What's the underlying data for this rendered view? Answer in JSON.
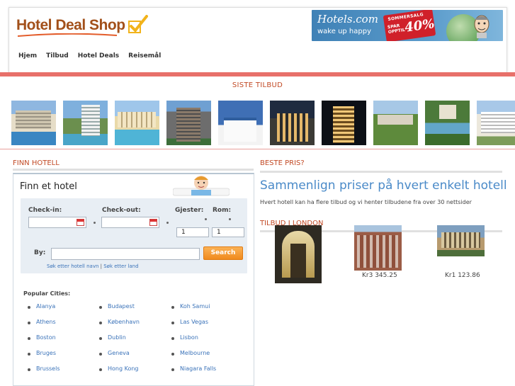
{
  "logo": {
    "text": "Hotel Deal Shop",
    "check_color": "#f2b31b"
  },
  "banner": {
    "brand": "Hotels.com",
    "tagline": "wake up happy",
    "sale_title": "SOMMERSALG",
    "sale_sub1": "SPAR",
    "sale_sub2": "OPPTIL",
    "sale_value": "40%"
  },
  "nav": {
    "items": [
      "Hjem",
      "Tilbud",
      "Hotel Deals",
      "Reisemål"
    ]
  },
  "latest": {
    "title": "SISTE TILBUD",
    "thumbs": [
      "hotel-thumb-1",
      "hotel-thumb-2",
      "hotel-thumb-3",
      "hotel-thumb-4",
      "hotel-thumb-5",
      "hotel-thumb-6",
      "hotel-thumb-7",
      "hotel-thumb-8",
      "hotel-thumb-9",
      "hotel-thumb-10"
    ]
  },
  "finn": {
    "section_label": "FINN HOTELL",
    "box_title": "Finn et hotel",
    "checkin_label": "Check-in:",
    "checkout_label": "Check-out:",
    "guests_label": "Gjester:",
    "rooms_label": "Rom:",
    "guests_value": "1",
    "rooms_value": "1",
    "by_label": "By:",
    "search_button": "Search",
    "link_name": "Søk etter hotell navn",
    "link_sep": "|",
    "link_country": "Søk etter land",
    "popular_title": "Popular Cities:",
    "cities_col1": [
      "Alanya",
      "Athens",
      "Boston",
      "Bruges",
      "Brussels"
    ],
    "cities_col2": [
      "Budapest",
      "København",
      "Dublin",
      "Geneva",
      "Hong Kong"
    ],
    "cities_col3": [
      "Koh Samui",
      "Las Vegas",
      "Lisbon",
      "Melbourne",
      "Niagara Falls"
    ]
  },
  "beste": {
    "section_label": "BESTE PRIS?",
    "headline": "Sammenlign priser på hvert enkelt hotell",
    "subtext": "Hvert hotell kan ha flere tilbud og vi henter tilbudene fra over 30 nettsider"
  },
  "tilbud": {
    "section_label": "TILBUD I LONDON",
    "offers": [
      {
        "price": ""
      },
      {
        "price": "Kr3 345.25"
      },
      {
        "price": "Kr1 123.86"
      }
    ]
  },
  "colors": {
    "accent_red": "#e8706a",
    "label_orange": "#c24a25",
    "link_blue": "#3b73b9",
    "search_orange": "#f08a1d"
  }
}
